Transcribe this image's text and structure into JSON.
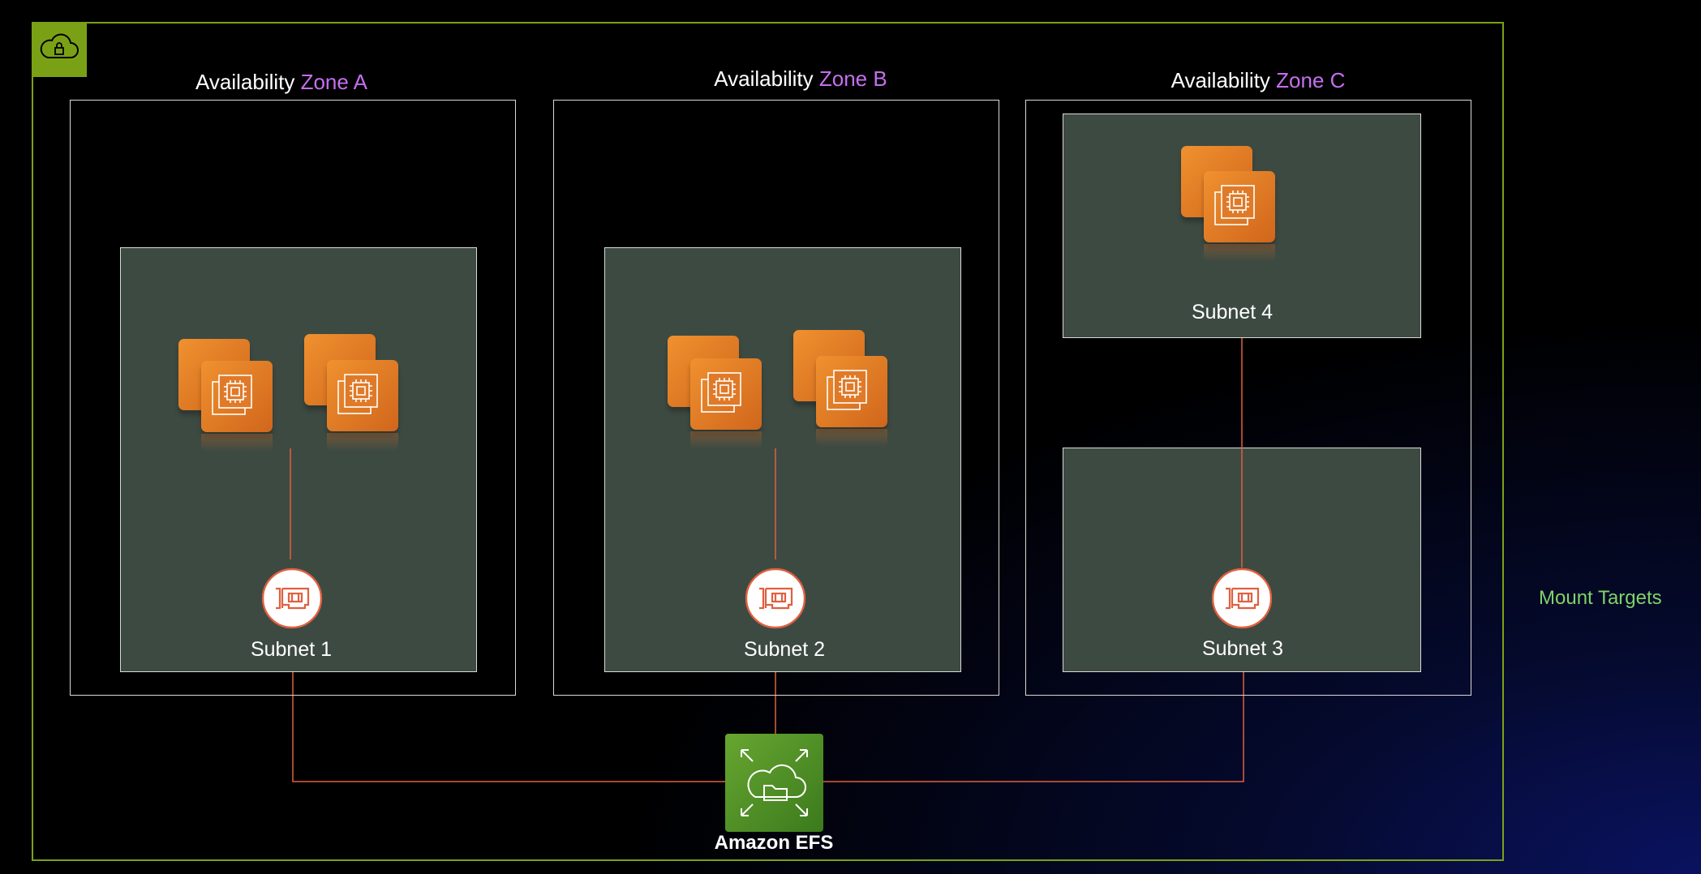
{
  "zones": [
    {
      "prefix": "Availability",
      "name": "Zone A"
    },
    {
      "prefix": "Availability",
      "name": "Zone B"
    },
    {
      "prefix": "Availability",
      "name": "Zone C"
    }
  ],
  "subnets": [
    "Subnet 1",
    "Subnet 2",
    "Subnet 3",
    "Subnet 4"
  ],
  "efs_label": "Amazon EFS",
  "mount_targets_label": "Mount Targets",
  "icons": {
    "vpc": "vpc-lock-cloud-icon",
    "ec2": "ec2-instances-icon",
    "mount_target": "network-interface-icon",
    "efs": "amazon-efs-icon"
  },
  "colors": {
    "vpc_border": "#7aa116",
    "zone_name": "#c56ff0",
    "subnet_fill": "#3d4a42",
    "connector": "#e0603f",
    "ec2": "#e8822a",
    "efs": "#4d8f27",
    "mount_targets_text": "#7fd36a"
  }
}
